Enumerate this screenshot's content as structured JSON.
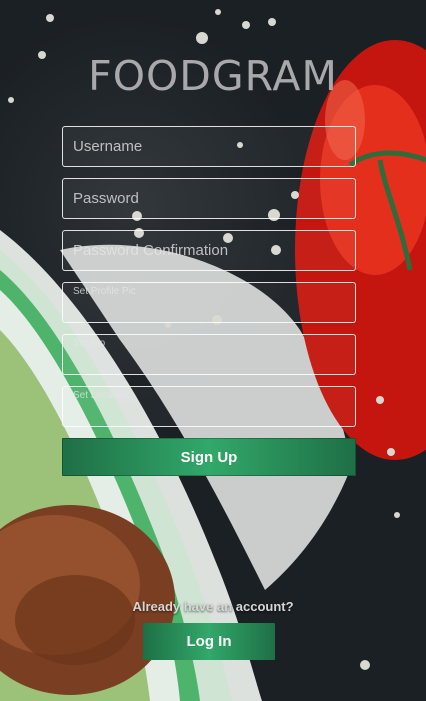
{
  "app": {
    "title": "FOODGRAM"
  },
  "signup_form": {
    "username_placeholder": "Username",
    "password_placeholder": "Password",
    "password_confirmation_placeholder": "Password Confirmation",
    "profile_pic_placeholder": "Set Profile Pic",
    "bio_placeholder": "Set Bio",
    "location_placeholder": "Set Location",
    "submit_label": "Sign Up"
  },
  "login": {
    "prompt": "Already have an account?",
    "button_label": "Log In"
  },
  "colors": {
    "button_green": "#2e9c5f",
    "title_gray": "#a9a9ab",
    "background_dark": "#1e2327"
  }
}
